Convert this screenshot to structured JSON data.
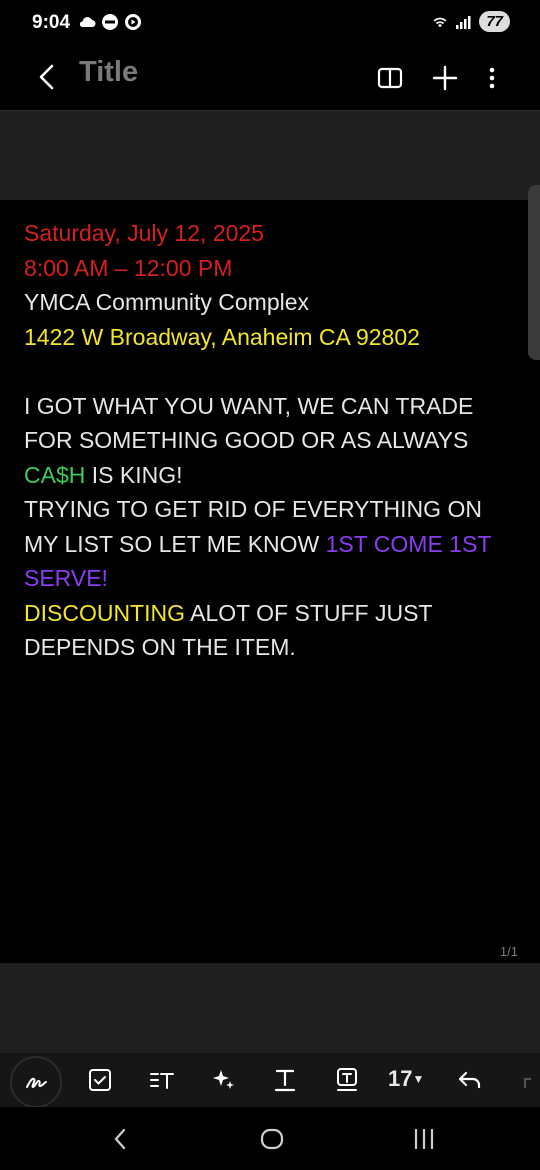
{
  "status_bar": {
    "time": "9:04",
    "battery": "77",
    "icons_left": [
      "cloud-icon",
      "brand-badge-icon",
      "play-icon"
    ],
    "icons_right": [
      "wifi-icon",
      "signal-icon",
      "battery-icon"
    ]
  },
  "app_bar": {
    "title": "Title",
    "actions": [
      "reading-mode-icon",
      "add-icon",
      "more-options-icon"
    ]
  },
  "note": {
    "lines": {
      "date": "Saturday, July 12, 2025",
      "time": "8:00 AM – 12:00 PM",
      "venue": "YMCA Community Complex",
      "address": "1422 W Broadway, Anaheim CA 92802",
      "p1_a": "I GOT WHAT YOU WANT, WE CAN TRADE FOR SOMETHING GOOD OR AS ALWAYS ",
      "p1_cash": "CA$H",
      "p1_b": " IS KING!",
      "p2_a": "TRYING TO GET RID OF EVERYTHING ON MY LIST SO LET ME KNOW ",
      "p2_first": "1ST COME 1ST SERVE!",
      "p3_disc": "DISCOUNTING",
      "p3_b": " ALOT OF STUFF JUST DEPENDS ON THE ITEM."
    },
    "page_indicator": "1/1"
  },
  "toolbar": {
    "font_size": "17",
    "tools": [
      "handwriting-icon",
      "checkbox-icon",
      "text-format-icon",
      "ai-sparkle-icon",
      "text-style-icon",
      "text-box-icon",
      "undo-icon"
    ]
  },
  "colors": {
    "red": "#d61f1f",
    "yellow": "#f2e52a",
    "green": "#3ecb5d",
    "purple": "#8a3df0"
  }
}
